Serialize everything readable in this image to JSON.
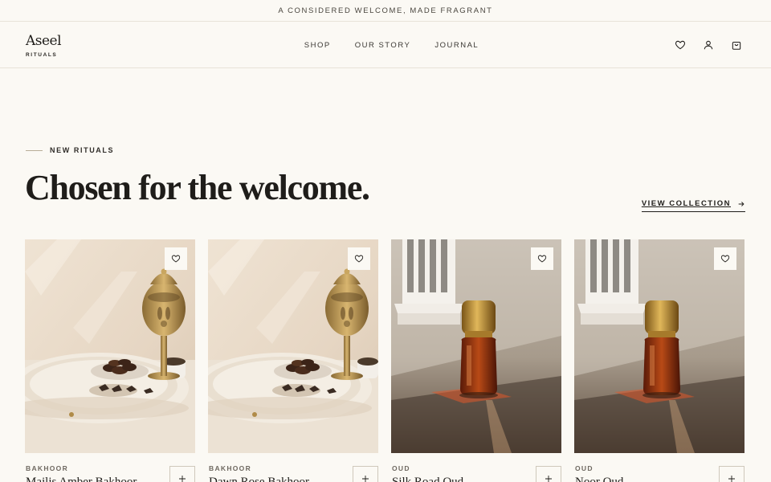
{
  "announcement": "A CONSIDERED WELCOME, MADE FRAGRANT",
  "brand": {
    "name": "Aseel",
    "subtitle": "RITUALS"
  },
  "nav": {
    "items": [
      {
        "label": "SHOP"
      },
      {
        "label": "OUR STORY"
      },
      {
        "label": "JOURNAL"
      }
    ]
  },
  "header_icons": [
    "heart-icon",
    "user-icon",
    "bag-icon"
  ],
  "section": {
    "eyebrow": "NEW RITUALS",
    "title": "Chosen for the welcome.",
    "view_link": "VIEW COLLECTION"
  },
  "products": [
    {
      "category": "BAKHOOR",
      "name": "Majlis Amber Bakhoor",
      "image": "bakhoor-burner"
    },
    {
      "category": "BAKHOOR",
      "name": "Dawn Rose Bakhoor",
      "image": "bakhoor-burner"
    },
    {
      "category": "OUD",
      "name": "Silk Road Oud",
      "image": "oud-bottle"
    },
    {
      "category": "OUD",
      "name": "Noor Oud",
      "image": "oud-bottle"
    }
  ],
  "colors": {
    "background": "#fbf9f4",
    "text": "#1f1d1a",
    "border": "#e8e3d8",
    "accent_line": "#b8ad98"
  }
}
